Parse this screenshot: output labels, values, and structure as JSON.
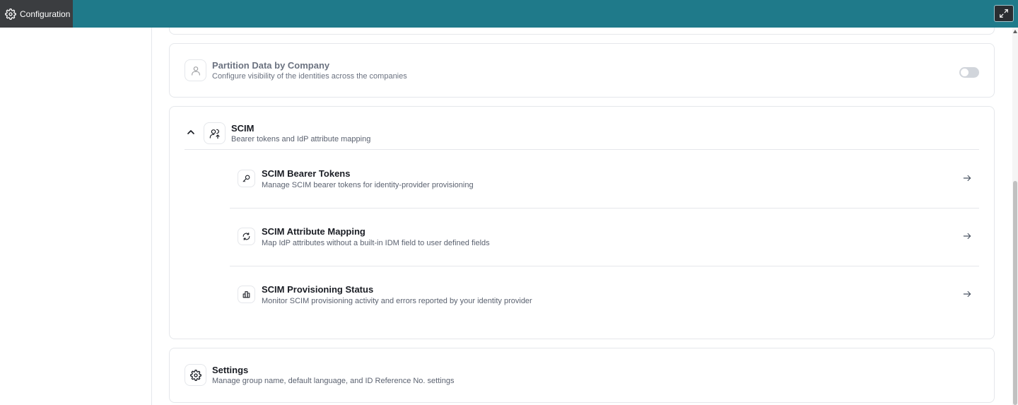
{
  "topbar": {
    "app_tab_label": "Configuration",
    "accent_color": "#1f7a8a",
    "icons": [
      "gear-icon",
      "expand-icon"
    ]
  },
  "partition": {
    "title": "Partition Data by Company",
    "subtitle": "Configure visibility of the identities across the companies",
    "toggle_on": false
  },
  "scim": {
    "title": "SCIM",
    "subtitle": "Bearer tokens and IdP attribute mapping",
    "expanded": true,
    "items": [
      {
        "title": "SCIM Bearer Tokens",
        "subtitle": "Manage SCIM bearer tokens for identity-provider provisioning",
        "icon": "key-icon"
      },
      {
        "title": "SCIM Attribute Mapping",
        "subtitle": "Map IdP attributes without a built-in IDM field to user defined fields",
        "icon": "sync-icon"
      },
      {
        "title": "SCIM Provisioning Status",
        "subtitle": "Monitor SCIM provisioning activity and errors reported by your identity provider",
        "icon": "bar-chart-icon"
      }
    ]
  },
  "settings": {
    "title": "Settings",
    "subtitle": "Manage group name, default language, and ID Reference No. settings"
  }
}
